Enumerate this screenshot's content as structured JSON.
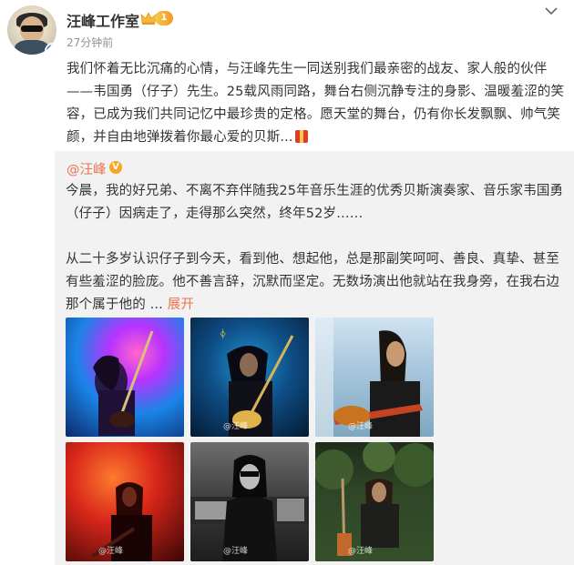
{
  "post": {
    "username": "汪峰工作室",
    "level": "1",
    "time": "27分钟前",
    "body": "我们怀着无比沉痛的心情，与汪峰先生一同送别我们最亲密的战友、家人般的伙伴——韦国勇（仔子）先生。25载风雨同路，舞台右侧沉静专注的身影、温暖羞涩的笑容，已成为我们共同记忆中最珍贵的定格。愿天堂的舞台，仍有你长发飘飘、帅气笑颜，并自由地弹拨着你最心爱的贝斯..."
  },
  "repost": {
    "author": "@汪峰",
    "paragraph1": "今晨，我的好兄弟、不离不弃伴随我25年音乐生涯的优秀贝斯演奏家、音乐家韦国勇（仔子）因病走了，走得那么突然，终年52岁……",
    "paragraph2": "从二十多岁认识仔子到今天，看到他、想起他，总是那副笑呵呵、善良、真挚、甚至有些羞涩的脸庞。他不善言辞，沉默而坚定。无数场演出他就站在我身旁，在我右边那个属于他的 ...",
    "expand": "展开",
    "photos": [
      {
        "name": "photo-bassist-purple-stage",
        "watermark": ""
      },
      {
        "name": "photo-bassist-blue-stage",
        "watermark": "@汪峰"
      },
      {
        "name": "photo-bassist-outdoor",
        "watermark": "@汪峰"
      },
      {
        "name": "photo-guitarist-red-stage",
        "watermark": "@汪峰"
      },
      {
        "name": "photo-portrait-studio",
        "watermark": "@汪峰"
      },
      {
        "name": "photo-portrait-garden",
        "watermark": "@汪峰"
      }
    ]
  },
  "colors": {
    "link": "#eb7350",
    "repost_bg": "#f2f2f2",
    "timestamp": "#939393"
  }
}
